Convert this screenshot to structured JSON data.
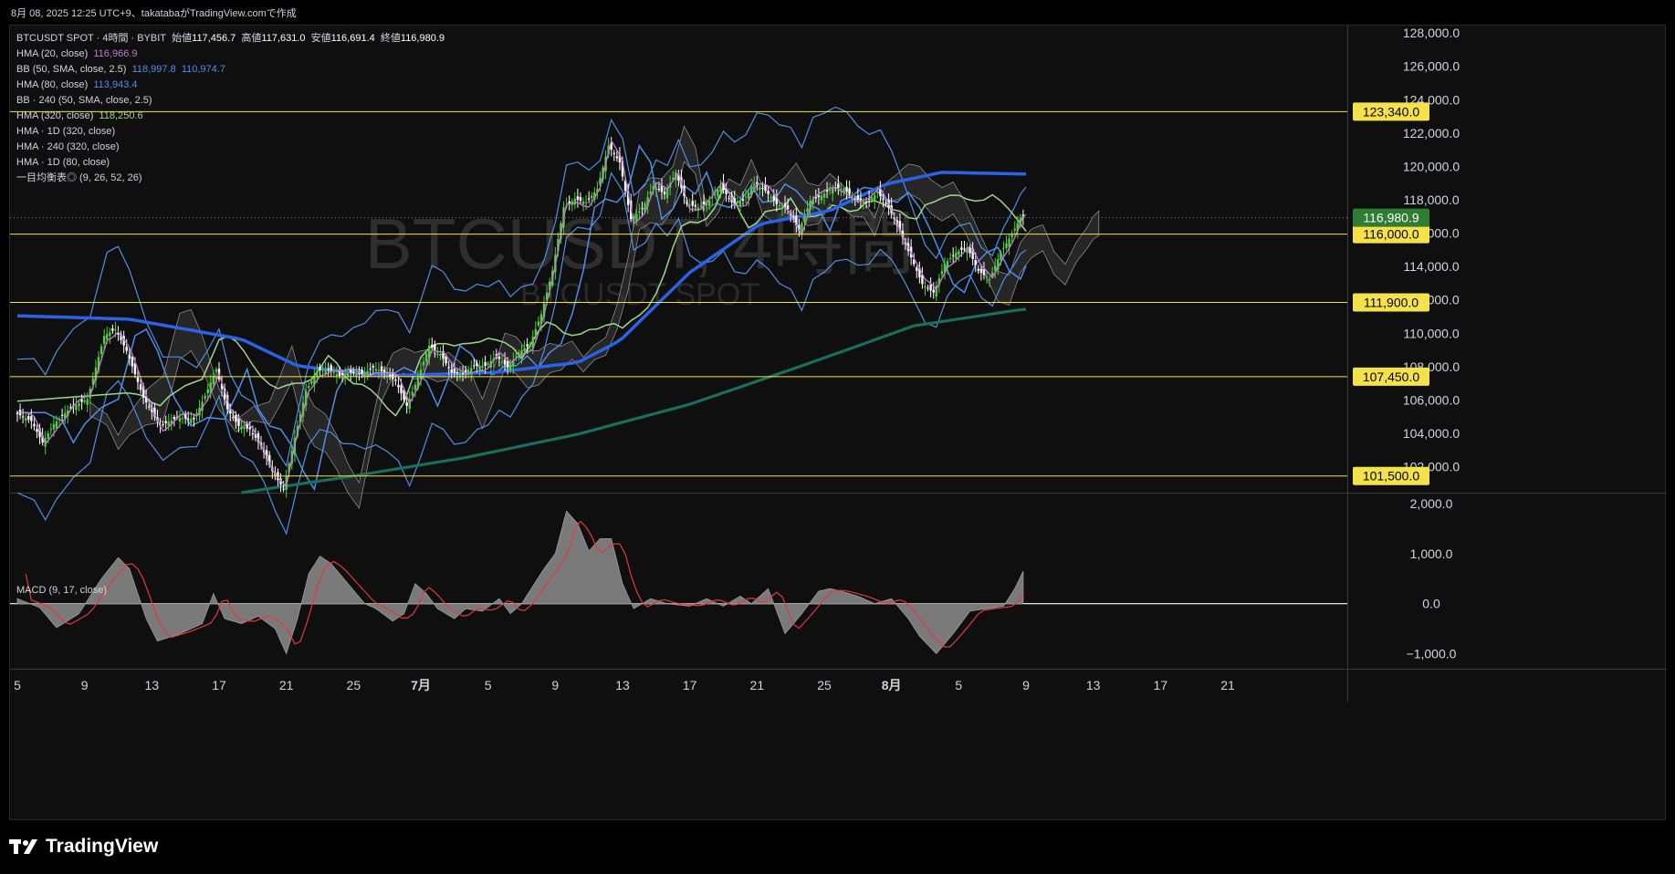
{
  "header": {
    "caption": "8月 08, 2025 12:25 UTC+9、takatabaがTradingView.comで作成"
  },
  "legend": {
    "symbol": "BTCUSDT SPOT · 4時間 · BYBIT",
    "open_label": "始値",
    "open": "117,456.7",
    "high_label": "高値",
    "high": "117,631.0",
    "low_label": "安値",
    "low": "116,691.4",
    "close_label": "終値",
    "close": "116,980.9",
    "rows": [
      {
        "label": "HMA (20, close)",
        "v1": "116,966.9",
        "v2": ""
      },
      {
        "label": "BB (50, SMA, close, 2.5)",
        "v1": "118,997.8",
        "v2": "110,974.7"
      },
      {
        "label": "HMA (80, close)",
        "v1": "113,943.4",
        "v2": ""
      },
      {
        "label": "BB · 240 (50, SMA, close, 2.5)",
        "v1": "",
        "v2": ""
      },
      {
        "label": "HMA (320, close)",
        "v1": "118,250.6",
        "v2": ""
      },
      {
        "label": "HMA · 1D (320, close)",
        "v1": "",
        "v2": ""
      },
      {
        "label": "HMA · 240 (320, close)",
        "v1": "",
        "v2": ""
      },
      {
        "label": "HMA · 1D (80, close)",
        "v1": "",
        "v2": ""
      },
      {
        "label": "一目均衡表◎ (9, 26, 52, 26)",
        "v1": "",
        "v2": ""
      }
    ]
  },
  "watermark": {
    "title": "BTCUSDT, 4時間",
    "subtitle": "BTCUSDT SPOT"
  },
  "macd_label": "MACD (9, 17, close)",
  "footer": {
    "brand": "TradingView"
  },
  "colors": {
    "up": "#4cd137",
    "down": "#ffffff",
    "hma20": "#c679d6",
    "bb": "#4f8fe6",
    "hma80": "#4f8fe6",
    "hma320": "#9fd68a",
    "hma1d320": "#2a62e8",
    "hma1d80": "#18705a",
    "level": "#f5e14a",
    "macd_hist": "#7a7a7a",
    "signal": "#e53935"
  },
  "chart_data": [
    {
      "type": "candlestick",
      "title": "BTCUSDT, 4時間",
      "ylim": [
        100500,
        128500
      ],
      "yticks": [
        "128,000.0",
        "126,000.0",
        "124,000.0",
        "122,000.0",
        "120,000.0",
        "118,000.0",
        "116,000.0",
        "114,000.0",
        "112,000.0",
        "110,000.0",
        "108,000.0",
        "106,000.0",
        "104,000.0",
        "102,000.0"
      ],
      "xticks": [
        "5",
        "9",
        "13",
        "17",
        "21",
        "25",
        "7月",
        "5",
        "9",
        "13",
        "17",
        "21",
        "25",
        "8月",
        "5",
        "9",
        "13",
        "17",
        "21"
      ],
      "close_value": 116980.9,
      "close_label": "116,980.9",
      "price_levels": [
        {
          "value": 123340,
          "label": "123,340.0"
        },
        {
          "value": 116000,
          "label": "116,000.0"
        },
        {
          "value": 111900,
          "label": "111,900.0"
        },
        {
          "value": 107450,
          "label": "107,450.0"
        },
        {
          "value": 101500,
          "label": "101,500.0"
        }
      ],
      "close_path": [
        [
          0,
          105300
        ],
        [
          6,
          104800
        ],
        [
          10,
          103500
        ],
        [
          14,
          104600
        ],
        [
          20,
          105600
        ],
        [
          26,
          106100
        ],
        [
          32,
          109900
        ],
        [
          36,
          110300
        ],
        [
          40,
          109000
        ],
        [
          46,
          106200
        ],
        [
          52,
          104500
        ],
        [
          58,
          105000
        ],
        [
          64,
          104900
        ],
        [
          68,
          106300
        ],
        [
          72,
          107900
        ],
        [
          76,
          105500
        ],
        [
          80,
          104500
        ],
        [
          84,
          104300
        ],
        [
          88,
          103300
        ],
        [
          92,
          101800
        ],
        [
          96,
          100700
        ],
        [
          100,
          103800
        ],
        [
          104,
          106600
        ],
        [
          108,
          107800
        ],
        [
          112,
          107900
        ],
        [
          116,
          107500
        ],
        [
          120,
          107700
        ],
        [
          124,
          107600
        ],
        [
          128,
          108000
        ],
        [
          132,
          107700
        ],
        [
          136,
          107200
        ],
        [
          140,
          105700
        ],
        [
          144,
          107400
        ],
        [
          148,
          109300
        ],
        [
          152,
          108800
        ],
        [
          156,
          107700
        ],
        [
          160,
          107600
        ],
        [
          164,
          108100
        ],
        [
          168,
          108100
        ],
        [
          172,
          108700
        ],
        [
          176,
          108000
        ],
        [
          180,
          108900
        ],
        [
          184,
          109400
        ],
        [
          188,
          111200
        ],
        [
          192,
          113800
        ],
        [
          196,
          117600
        ],
        [
          200,
          118100
        ],
        [
          204,
          117900
        ],
        [
          208,
          118700
        ],
        [
          212,
          121300
        ],
        [
          216,
          120300
        ],
        [
          220,
          116900
        ],
        [
          224,
          117500
        ],
        [
          228,
          118900
        ],
        [
          232,
          118400
        ],
        [
          236,
          119700
        ],
        [
          240,
          117800
        ],
        [
          244,
          117600
        ],
        [
          248,
          118000
        ],
        [
          252,
          118900
        ],
        [
          256,
          117900
        ],
        [
          260,
          118000
        ],
        [
          264,
          119000
        ],
        [
          268,
          118600
        ],
        [
          272,
          117800
        ],
        [
          276,
          117500
        ],
        [
          280,
          116200
        ],
        [
          284,
          118000
        ],
        [
          288,
          118300
        ],
        [
          292,
          118800
        ],
        [
          296,
          118700
        ],
        [
          300,
          118100
        ],
        [
          304,
          117900
        ],
        [
          308,
          118500
        ],
        [
          312,
          117600
        ],
        [
          316,
          116200
        ],
        [
          320,
          114600
        ],
        [
          324,
          113000
        ],
        [
          328,
          112500
        ],
        [
          332,
          114200
        ],
        [
          336,
          114900
        ],
        [
          340,
          115200
        ],
        [
          344,
          113800
        ],
        [
          348,
          113300
        ],
        [
          352,
          114900
        ],
        [
          356,
          116000
        ],
        [
          359,
          116981
        ]
      ],
      "series": [
        {
          "name": "HMA (20, close)",
          "last": 116966.9
        },
        {
          "name": "BB (50, SMA, close, 2.5)",
          "upper_last": 118997.8,
          "lower_last": 110974.7
        },
        {
          "name": "HMA (80, close)",
          "last": 113943.4
        },
        {
          "name": "HMA (320, close)",
          "last": 118250.6
        }
      ]
    },
    {
      "type": "area",
      "title": "MACD (9, 17, close)",
      "ylim": [
        -1300,
        2200
      ],
      "yticks": [
        "2,000.0",
        "1,000.0",
        "0.0",
        "−1,000.0"
      ],
      "hist_path": [
        [
          0,
          100
        ],
        [
          8,
          -80
        ],
        [
          14,
          -480
        ],
        [
          22,
          -200
        ],
        [
          30,
          500
        ],
        [
          36,
          920
        ],
        [
          40,
          700
        ],
        [
          46,
          -300
        ],
        [
          50,
          -750
        ],
        [
          58,
          -600
        ],
        [
          66,
          -400
        ],
        [
          70,
          200
        ],
        [
          74,
          -300
        ],
        [
          80,
          -400
        ],
        [
          86,
          -250
        ],
        [
          92,
          -500
        ],
        [
          96,
          -1000
        ],
        [
          100,
          -300
        ],
        [
          104,
          600
        ],
        [
          108,
          950
        ],
        [
          112,
          800
        ],
        [
          118,
          400
        ],
        [
          124,
          0
        ],
        [
          128,
          -100
        ],
        [
          134,
          -350
        ],
        [
          138,
          -200
        ],
        [
          142,
          400
        ],
        [
          146,
          200
        ],
        [
          150,
          -100
        ],
        [
          156,
          -300
        ],
        [
          160,
          -100
        ],
        [
          166,
          -150
        ],
        [
          172,
          100
        ],
        [
          176,
          -200
        ],
        [
          180,
          0
        ],
        [
          184,
          350
        ],
        [
          188,
          700
        ],
        [
          192,
          1000
        ],
        [
          196,
          1850
        ],
        [
          200,
          1600
        ],
        [
          204,
          1050
        ],
        [
          208,
          1300
        ],
        [
          212,
          1300
        ],
        [
          216,
          400
        ],
        [
          220,
          -100
        ],
        [
          226,
          100
        ],
        [
          232,
          0
        ],
        [
          240,
          -50
        ],
        [
          246,
          100
        ],
        [
          252,
          -50
        ],
        [
          258,
          150
        ],
        [
          262,
          0
        ],
        [
          268,
          300
        ],
        [
          274,
          -600
        ],
        [
          280,
          -200
        ],
        [
          286,
          250
        ],
        [
          290,
          300
        ],
        [
          294,
          250
        ],
        [
          300,
          150
        ],
        [
          306,
          0
        ],
        [
          312,
          100
        ],
        [
          318,
          -300
        ],
        [
          322,
          -650
        ],
        [
          328,
          -1000
        ],
        [
          334,
          -600
        ],
        [
          340,
          -150
        ],
        [
          346,
          -100
        ],
        [
          352,
          -50
        ],
        [
          356,
          300
        ],
        [
          359,
          650
        ]
      ]
    }
  ]
}
